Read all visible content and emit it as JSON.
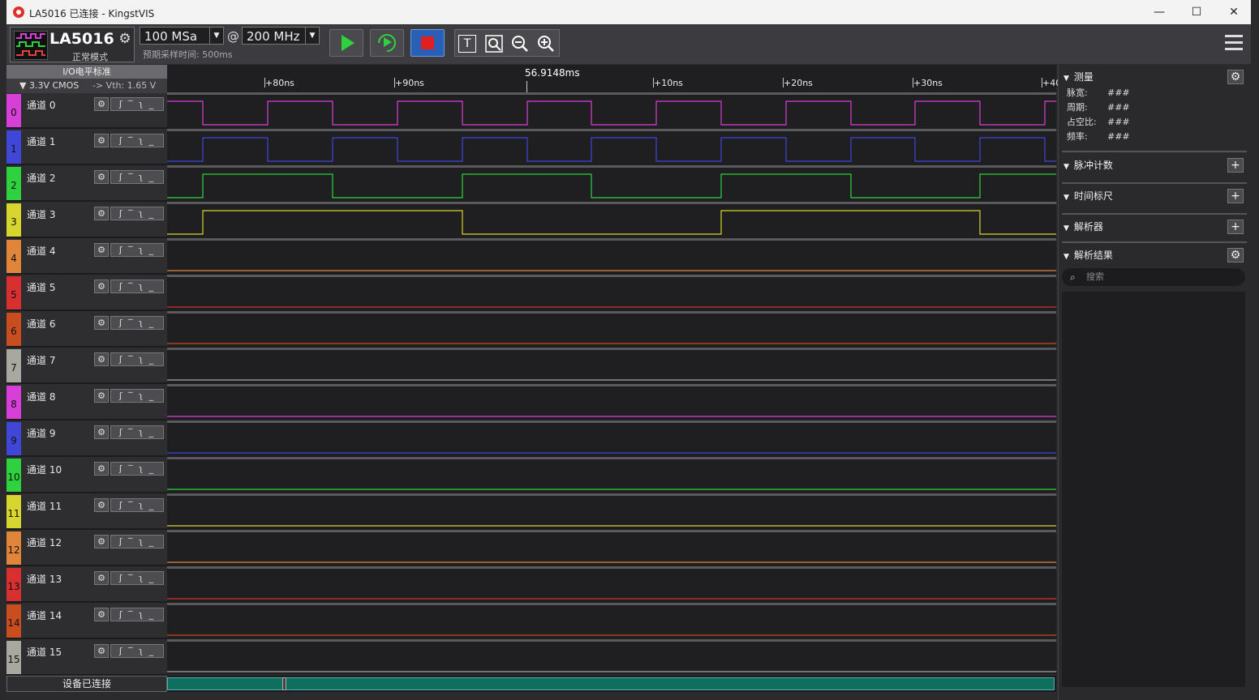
{
  "window": {
    "title": "LA5016 已连接 - KingstVIS",
    "controls": {
      "minimize": "—",
      "maximize": "☐",
      "close": "✕"
    }
  },
  "toolbar": {
    "device_name": "LA5016",
    "device_mode": "正常模式",
    "sample_depth": "100 MSa",
    "at": "@",
    "sample_rate": "200 MHz",
    "expected_time": "预期采样时间: 500ms",
    "zoom_text_icon": "T"
  },
  "io_standard": {
    "header": "I/O电平标准",
    "value": "▼  3.3V CMOS",
    "vth": "-> Vth: 1.65 V"
  },
  "channels": [
    {
      "num": "0",
      "name": "通道 0",
      "color": "#d83fd8"
    },
    {
      "num": "1",
      "name": "通道 1",
      "color": "#3f46d8"
    },
    {
      "num": "2",
      "name": "通道 2",
      "color": "#2ed23e"
    },
    {
      "num": "3",
      "name": "通道 3",
      "color": "#d6d62e"
    },
    {
      "num": "4",
      "name": "通道 4",
      "color": "#e0853a"
    },
    {
      "num": "5",
      "name": "通道 5",
      "color": "#d83030"
    },
    {
      "num": "6",
      "name": "通道 6",
      "color": "#c84e20"
    },
    {
      "num": "7",
      "name": "通道 7",
      "color": "#a8a8a0"
    },
    {
      "num": "8",
      "name": "通道 8",
      "color": "#d83fd8"
    },
    {
      "num": "9",
      "name": "通道 9",
      "color": "#3f46d8"
    },
    {
      "num": "10",
      "name": "通道 10",
      "color": "#2ed23e"
    },
    {
      "num": "11",
      "name": "通道 11",
      "color": "#d6d62e"
    },
    {
      "num": "12",
      "name": "通道 12",
      "color": "#e0853a"
    },
    {
      "num": "13",
      "name": "通道 13",
      "color": "#d83030"
    },
    {
      "num": "14",
      "name": "通道 14",
      "color": "#c84e20"
    },
    {
      "num": "15",
      "name": "通道 15",
      "color": "#a8a8a0"
    }
  ],
  "channel_trigger_icons": "ʃ ‾ ʅ _",
  "status": "设备已连接",
  "timeline": {
    "center_label": "56.9148ms",
    "ticks": [
      "+80ns",
      "+90ns",
      "+10ns",
      "+20ns",
      "+30ns",
      "+40"
    ]
  },
  "right_panel": {
    "measure": {
      "title": "测量",
      "rows": [
        {
          "key": "脉宽:",
          "value": "###"
        },
        {
          "key": "周期:",
          "value": "###"
        },
        {
          "key": "占空比:",
          "value": "###"
        },
        {
          "key": "频率:",
          "value": "###"
        }
      ]
    },
    "pulse_count": "脉冲计数",
    "time_ruler": "时间标尺",
    "analyzer": "解析器",
    "results": "解析结果",
    "search_placeholder": "搜索",
    "plus": "+",
    "gear": "⚙"
  }
}
